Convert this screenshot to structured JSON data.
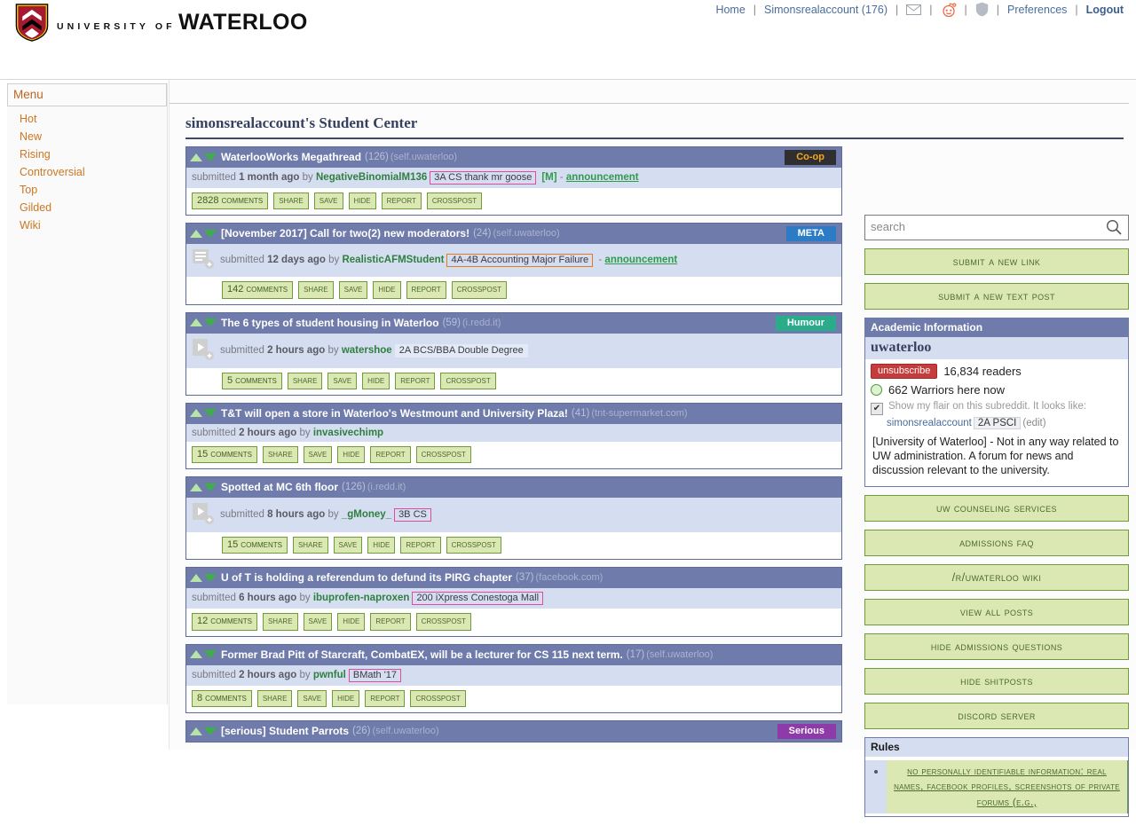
{
  "header": {
    "logo_line1": "UNIVERSITY OF",
    "logo_line2": "WATERLOO",
    "logo_icon": "waterloo-shield-icon",
    "nav": {
      "home": "Home",
      "account": "Simonsrealaccount (176)",
      "mail_icon": "envelope-icon",
      "reddit_icon": "reddit-alien-icon",
      "shield_icon": "mod-shield-icon",
      "preferences": "Preferences",
      "logout": "Logout",
      "separator": "|"
    }
  },
  "menu": {
    "title": "Menu",
    "items": [
      {
        "label": "Hot"
      },
      {
        "label": "New"
      },
      {
        "label": "Rising"
      },
      {
        "label": "Controversial"
      },
      {
        "label": "Top"
      },
      {
        "label": "Gilded"
      },
      {
        "label": "Wiki"
      }
    ]
  },
  "main": {
    "page_title": "simonsrealaccount's Student Center",
    "actions": {
      "share": "share",
      "save": "save",
      "hide": "hide",
      "report": "report",
      "crosspost": "crosspost"
    },
    "submitted_word": "submitted",
    "by_word": "by",
    "posts": [
      {
        "title": "WaterlooWorks Megathread",
        "score": "(126)",
        "domain": "(self.uwaterloo)",
        "flair": "Co-op",
        "flair_class": "flair-coop",
        "time": "1 month ago",
        "author": "NegativeBinomialM136",
        "userflair": "3A CS thank mr goose",
        "userflair_color": "pink",
        "mod_tag": "[M]",
        "dash": "-",
        "announcement": "announcement",
        "comments": "2828 comments",
        "thumb": "none",
        "indent": false
      },
      {
        "title": "[November 2017] Call for two(2) new moderators!",
        "score": "(24)",
        "domain": "(self.uwaterloo)",
        "flair": "META",
        "flair_class": "flair-meta",
        "time": "12 days ago",
        "author": "RealisticAFMStudent",
        "userflair": "4A-4B Accounting Major Failure",
        "userflair_color": "orange",
        "mod_tag": "",
        "dash": "-",
        "announcement": "announcement",
        "comments": "142 comments",
        "thumb": "self-post-icon",
        "indent": true
      },
      {
        "title": "The 6 types of student housing in Waterloo",
        "score": "(59)",
        "domain": "(i.redd.it)",
        "flair": "Humour",
        "flair_class": "flair-humour",
        "time": "2 hours ago",
        "author": "watershoe",
        "userflair": "2A BCS/BBA Double Degree",
        "userflair_color": "none",
        "mod_tag": "",
        "dash": "",
        "announcement": "",
        "comments": "5 comments",
        "thumb": "image-post-icon",
        "indent": true
      },
      {
        "title": "T&T will open a store in Waterloo's Westmount and University Plaza!",
        "score": "(41)",
        "domain": "(tnt-supermarket.com)",
        "flair": "",
        "flair_class": "",
        "time": "2 hours ago",
        "author": "invasivechimp",
        "userflair": "",
        "userflair_color": "none",
        "mod_tag": "",
        "dash": "",
        "announcement": "",
        "comments": "15 comments",
        "thumb": "none",
        "indent": false
      },
      {
        "title": "Spotted at MC 6th floor",
        "score": "(126)",
        "domain": "(i.redd.it)",
        "flair": "",
        "flair_class": "",
        "time": "8 hours ago",
        "author": "_gMoney_",
        "userflair": "3B CS",
        "userflair_color": "pink",
        "mod_tag": "",
        "dash": "",
        "announcement": "",
        "comments": "15 comments",
        "thumb": "image-post-icon",
        "indent": true
      },
      {
        "title": "U of T is holding a referendum to defund its PIRG chapter",
        "score": "(37)",
        "domain": "(facebook.com)",
        "flair": "",
        "flair_class": "",
        "time": "6 hours ago",
        "author": "ibuprofen-naproxen",
        "userflair": "200 iXpress Conestoga Mall",
        "userflair_color": "pink",
        "mod_tag": "",
        "dash": "",
        "announcement": "",
        "comments": "12 comments",
        "thumb": "none",
        "indent": false
      },
      {
        "title": "Former Brad Pitt of Starcraft, CombatEX, will be a lecturer for CS 115 next term.",
        "score": "(17)",
        "domain": "(self.uwaterloo)",
        "flair": "",
        "flair_class": "",
        "time": "2 hours ago",
        "author": "pwnful",
        "userflair": "BMath '17",
        "userflair_color": "pink",
        "mod_tag": "",
        "dash": "",
        "announcement": "",
        "comments": "8 comments",
        "thumb": "none",
        "indent": false
      },
      {
        "title": "[serious] Student Parrots",
        "score": "(26)",
        "domain": "(self.uwaterloo)",
        "flair": "Serious",
        "flair_class": "flair-serious",
        "time": "",
        "author": "",
        "userflair": "",
        "userflair_color": "none",
        "mod_tag": "",
        "dash": "",
        "announcement": "",
        "comments": "",
        "thumb": "none",
        "indent": false
      }
    ]
  },
  "sidebar": {
    "search_placeholder": "search",
    "search_icon": "search-icon",
    "submit_link": "submit a new link",
    "submit_text": "submit a new text post",
    "academic_header": "Academic Information",
    "subreddit_name": "uwaterloo",
    "unsubscribe": "unsubscribe",
    "readers": "16,834 readers",
    "online": "662 Warriors here now",
    "flair_checkbox_label": "Show my flair on this subreddit. It looks like:",
    "flair_check_glyph": "✔",
    "flair_username": "simonsrealaccount",
    "flair_value": "2A PSCI",
    "flair_edit": "(edit)",
    "description": "[University of Waterloo] - Not in any way related to UW administration. A forum for news and discussion relevant to the university.",
    "buttons": [
      {
        "label": "UW Counseling Services"
      },
      {
        "label": "Admissions FAQ"
      },
      {
        "label": "/r/uwaterloo Wiki"
      },
      {
        "label": "View All Posts"
      },
      {
        "label": "Hide Admissions Questions"
      },
      {
        "label": "Hide Shitposts"
      },
      {
        "label": "Discord Server"
      }
    ],
    "rules_header": "Rules",
    "rules": [
      {
        "text": "No Personally Identifiable Information: Real Names, Facebook Profiles, Screenshots Of Private Forums (E.G.,"
      }
    ]
  }
}
